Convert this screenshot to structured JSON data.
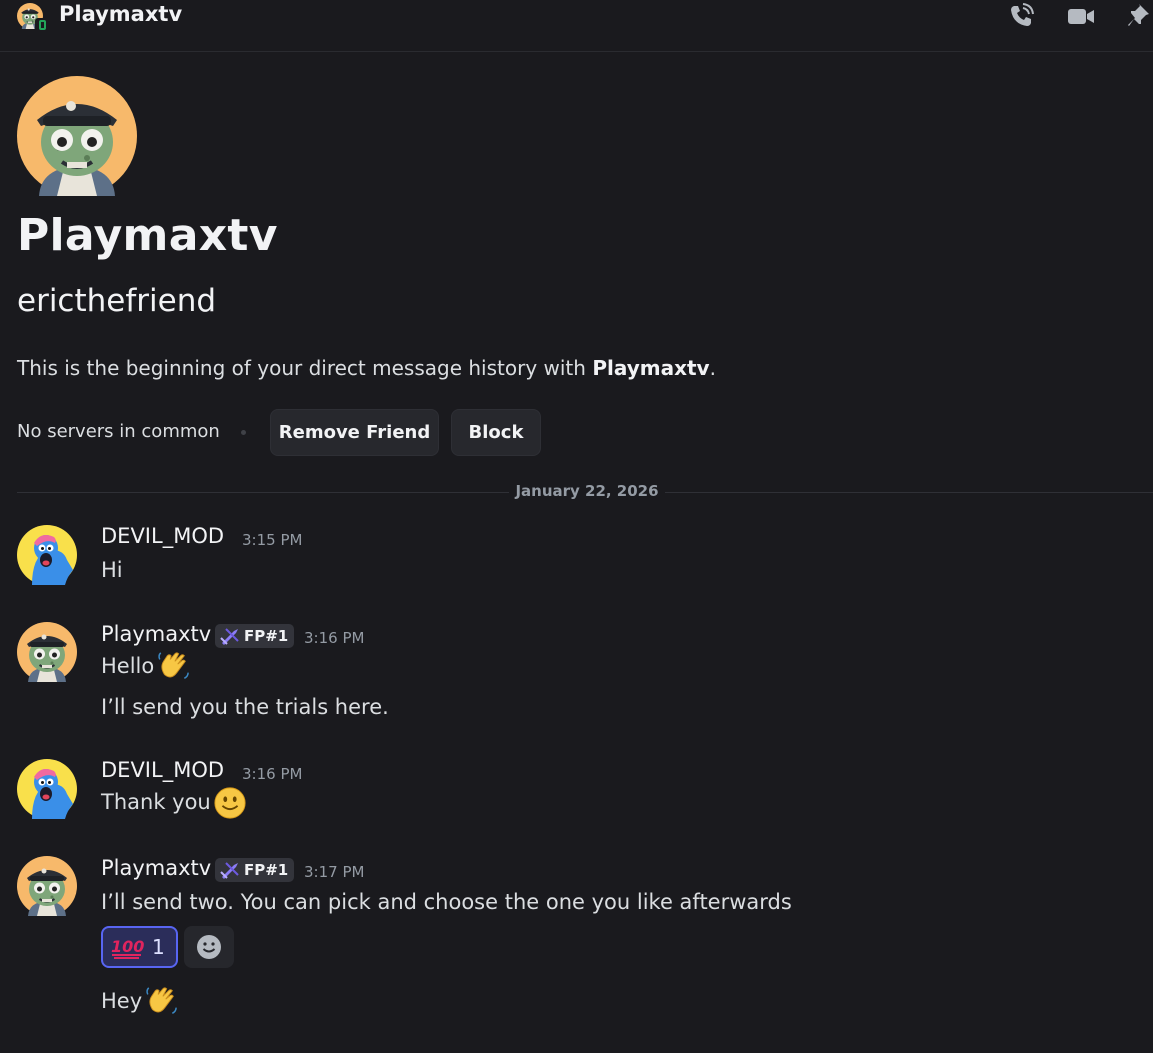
{
  "window": {
    "title": "Playmaxtv",
    "icons": [
      "phone-call-icon",
      "video-call-icon",
      "pin-icon"
    ]
  },
  "profile": {
    "display_name": "Playmaxtv",
    "username": "ericthefriend",
    "intro_prefix": "This is the beginning of your direct message history with ",
    "intro_name": "Playmaxtv",
    "intro_suffix": ".",
    "common_servers": "No servers in common",
    "remove_friend_label": "Remove Friend",
    "block_label": "Block"
  },
  "divider": {
    "date": "January 22, 2026"
  },
  "messages": [
    {
      "author": "DEVIL_MOD",
      "time": "3:15 PM",
      "lines": [
        "Hi"
      ]
    },
    {
      "author": "Playmaxtv",
      "tag": "FP#1",
      "time": "3:16 PM",
      "lines": [
        "Hello",
        "I’ll send you the trials here."
      ],
      "emoji": "waving-hand"
    },
    {
      "author": "DEVIL_MOD",
      "time": "3:16 PM",
      "lines": [
        "Thank you"
      ],
      "emoji": "slightly-smiling-face"
    },
    {
      "author": "Playmaxtv",
      "tag": "FP#1",
      "time": "3:17 PM",
      "lines": [
        "I’ll send two. You can pick and choose the one you like afterwards",
        "Hey"
      ],
      "emoji": "waving-hand"
    }
  ],
  "reaction": {
    "emoji": "hundred-points",
    "count": "1"
  },
  "colors": {
    "background": "#1a1a1e",
    "accent": "#5865f2",
    "online": "#23a55a"
  }
}
